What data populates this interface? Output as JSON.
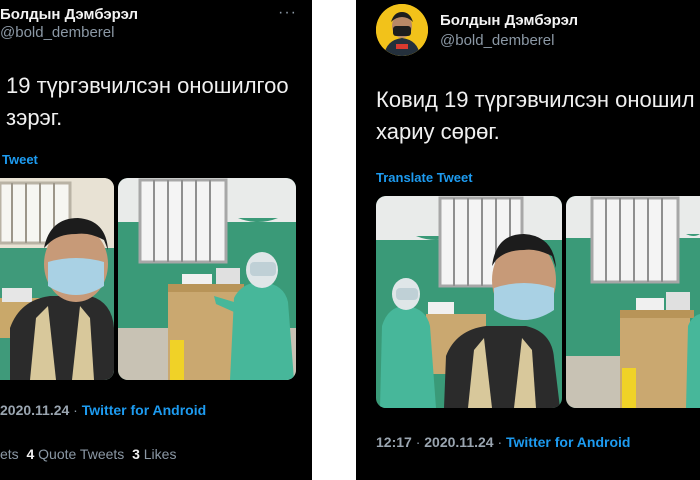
{
  "left": {
    "name": "Болдын Дэмбэрэл",
    "handle": "@bold_demberel",
    "more": "···",
    "text_line1": "19 түргэвчилсэн оношилгоо",
    "text_line2": "зэрэг.",
    "translate": "Tweet",
    "date": "2020.11.24",
    "separator": " · ",
    "client": "Twitter for Android",
    "stats_prefix": "ets",
    "quote_count": "4",
    "quote_label": "Quote Tweets",
    "like_count": "3",
    "like_label": "Likes"
  },
  "right": {
    "name": "Болдын Дэмбэрэл",
    "handle": "@bold_demberel",
    "text_line1": "Ковид 19 түргэвчилсэн оношил",
    "text_line2": "хариу сөрөг.",
    "translate": "Translate Tweet",
    "time": "12:17",
    "separator": " · ",
    "date": "2020.11.24",
    "separator2": " · ",
    "client": "Twitter for Android"
  },
  "colors": {
    "background": "#000000",
    "link": "#1d9bf0",
    "secondary": "#8b98a5",
    "avatar_bg": "#f2c21a",
    "wall_green": "#3a9a78"
  },
  "icons": [
    "more-icon",
    "avatar-image"
  ]
}
